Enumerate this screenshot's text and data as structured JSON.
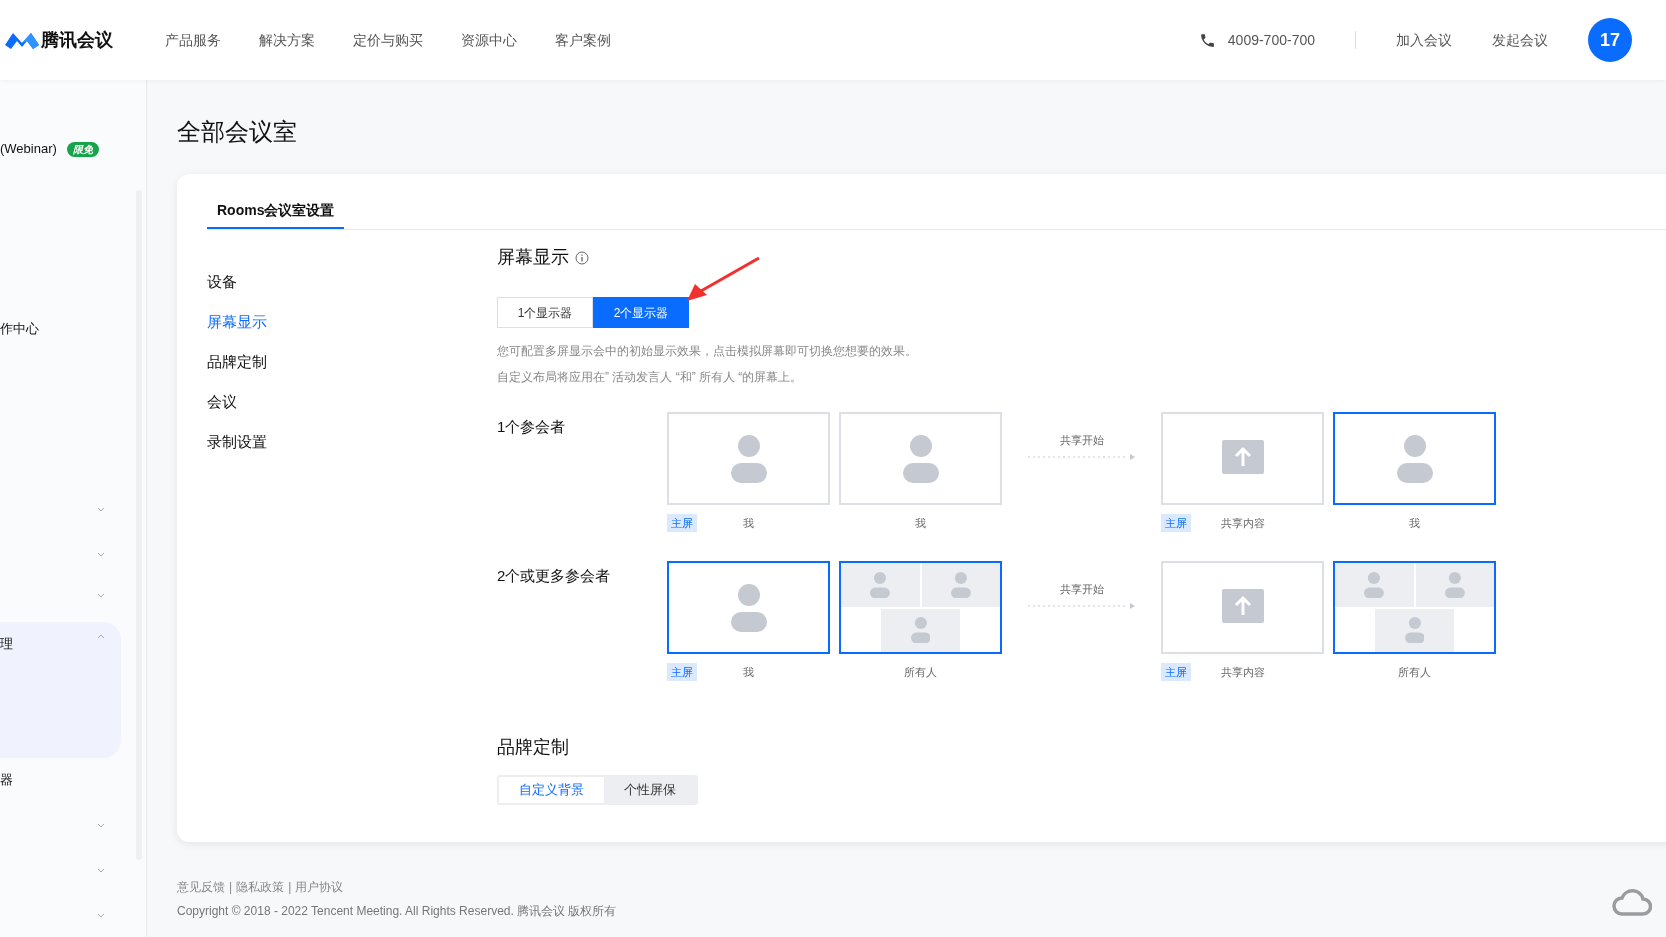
{
  "header": {
    "logo_text": "腾讯会议",
    "nav": [
      "产品服务",
      "解决方案",
      "定价与购买",
      "资源中心",
      "客户案例"
    ],
    "phone": "4009-700-700",
    "actions": [
      "加入会议",
      "发起会议"
    ],
    "avatar": "17"
  },
  "sidebar": {
    "items": [
      {
        "label": "(Webinar)",
        "badge": "限免"
      },
      {
        "label": "作中心"
      },
      {
        "expanded": false
      },
      {
        "expanded": false
      },
      {
        "expanded": false
      },
      {
        "label": "理",
        "expanded": true,
        "selected": true
      },
      {
        "label": "器"
      },
      {
        "expanded": false
      },
      {
        "expanded": false
      },
      {
        "expanded": false
      }
    ]
  },
  "page_title": "全部会议室",
  "card": {
    "tabs": [
      {
        "label": "Rooms会议室设置",
        "selected": true
      }
    ],
    "menu": [
      {
        "label": "设备",
        "selected": false
      },
      {
        "label": "屏幕显示",
        "selected": true
      },
      {
        "label": "品牌定制",
        "selected": false
      },
      {
        "label": "会议",
        "selected": false
      },
      {
        "label": "录制设置",
        "selected": false
      }
    ],
    "section_title": "屏幕显示",
    "monitor_options": [
      {
        "label": "1个显示器",
        "selected": false
      },
      {
        "label": "2个显示器",
        "selected": true
      }
    ],
    "descriptions": [
      "您可配置多屏显示会中的初始显示效果，点击模拟屏幕即可切换您想要的效果。",
      "自定义布局将应用在” 活动发言人 “和” 所有人 “的屏幕上。"
    ],
    "rows": [
      {
        "label": "1个参会者",
        "share_label": "共享开始",
        "screens": [
          {
            "kind": "person",
            "selected": false,
            "tag": "主屏",
            "caption": "我"
          },
          {
            "kind": "person",
            "selected": false,
            "caption": "我"
          },
          {
            "kind": "share",
            "selected": false,
            "tag": "主屏",
            "caption": "共享内容"
          },
          {
            "kind": "person",
            "selected": true,
            "caption": "我"
          }
        ]
      },
      {
        "label": "2个或更多参会者",
        "share_label": "共享开始",
        "screens": [
          {
            "kind": "person",
            "selected": true,
            "tag": "主屏",
            "caption": "我"
          },
          {
            "kind": "grid",
            "selected": true,
            "caption": "所有人"
          },
          {
            "kind": "share",
            "selected": false,
            "tag": "主屏",
            "caption": "共享内容"
          },
          {
            "kind": "grid",
            "selected": true,
            "caption": "所有人"
          }
        ]
      }
    ],
    "brand_title": "品牌定制",
    "brand_tabs": [
      {
        "label": "自定义背景",
        "selected": true
      },
      {
        "label": "个性屏保",
        "selected": false
      }
    ]
  },
  "footer": {
    "links": [
      "意见反馈",
      "隐私政策",
      "用户协议"
    ],
    "separator": "|",
    "copyright": "Copyright © 2018 - 2022 Tencent Meeting. All Rights Reserved. 腾讯会议 版权所有"
  }
}
